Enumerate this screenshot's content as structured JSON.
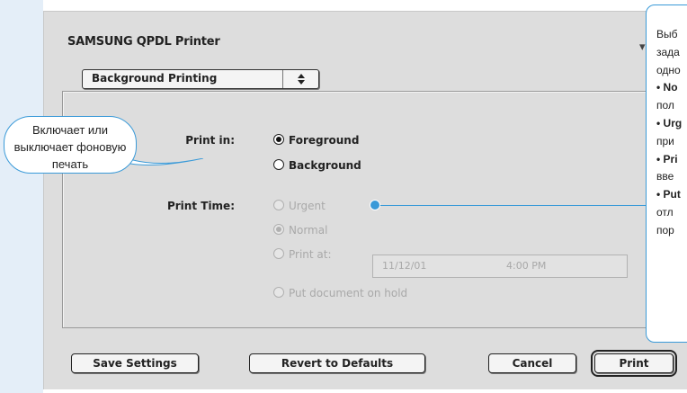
{
  "dialog": {
    "title": "SAMSUNG QPDL Printer",
    "chevron": "▾",
    "panel_select": {
      "value": "Background Printing",
      "arrows": "▲▼"
    }
  },
  "print_in": {
    "label": "Print in:",
    "options": [
      {
        "label": "Foreground",
        "selected": true,
        "enabled": true
      },
      {
        "label": "Background",
        "selected": false,
        "enabled": true
      }
    ]
  },
  "print_time": {
    "label": "Print Time:",
    "options": [
      {
        "label": "Urgent",
        "selected": false,
        "enabled": false
      },
      {
        "label": "Normal",
        "selected": true,
        "enabled": false
      },
      {
        "label": "Print at:",
        "selected": false,
        "enabled": false
      },
      {
        "label": "Put document on hold",
        "selected": false,
        "enabled": false
      }
    ],
    "date": "11/12/01",
    "time": "4:00 PM"
  },
  "buttons": {
    "save": "Save Settings",
    "revert": "Revert to Defaults",
    "cancel": "Cancel",
    "print": "Print"
  },
  "callout": {
    "line1": "Включает или",
    "line2": "выключает фоновую",
    "line3": "печать"
  },
  "info": {
    "line1": "Выб",
    "line2": "зада",
    "line3": "одно",
    "item1_bullet": "• No",
    "item1_text": "пол",
    "item2_bullet": "• Urg",
    "item2_text": "при",
    "item3_bullet": "• Pri",
    "item3_text": "вве",
    "item4_bullet": "• Put",
    "item4_text": "отл",
    "item4_text2": "пор"
  },
  "colors": {
    "accent": "#3a9ad8",
    "dialog_bg": "#dddddd",
    "side_panel": "#e4eef8"
  }
}
